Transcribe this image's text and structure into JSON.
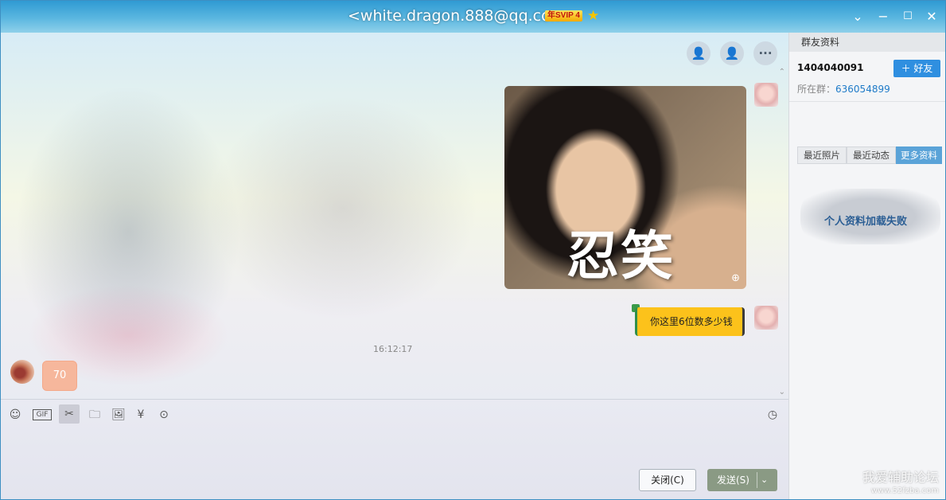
{
  "window": {
    "title": "<white.dragon.888@qq.com>",
    "vip_badge": "年SVIP 4",
    "vip_star_icon": "star-icon",
    "controls": [
      "chevron-down-icon",
      "minimize-icon",
      "maximize-icon",
      "close-icon"
    ]
  },
  "chat": {
    "tools": [
      "add-contact-icon",
      "contact-settings-icon",
      "more-icon"
    ],
    "image_message": {
      "caption": "忍笑",
      "zoom_icon": "zoom-in-icon"
    },
    "outgoing_text": "你这里6位数多少钱",
    "timestamp": "16:12:17",
    "incoming_text": "70"
  },
  "input_toolbar": {
    "icons": [
      "emoji-icon",
      "gif-icon",
      "scissors-icon",
      "folder-icon",
      "image-icon",
      "red-packet-icon",
      "more-dots-icon",
      "history-clock-icon"
    ],
    "gif_label": "GIF"
  },
  "buttons": {
    "close_label": "关闭(C)",
    "send_label": "发送(S)"
  },
  "panel": {
    "header": "群友资料",
    "qq_number": "1404040091",
    "add_friend_label": "好友",
    "group_label": "所在群：",
    "group_number": "636054899",
    "tabs": [
      "最近照片",
      "最近动态",
      "更多资料"
    ],
    "load_error": "个人资料加载失败"
  },
  "watermark": {
    "line1": "我爱辅助论坛",
    "line2": "www.52fzba.com"
  },
  "colors": {
    "title_blue": "#2f9ad3",
    "bubble_yellow": "#fcc21b",
    "bubble_peach": "#f6b79c",
    "accent_blue": "#2f8fe0"
  }
}
